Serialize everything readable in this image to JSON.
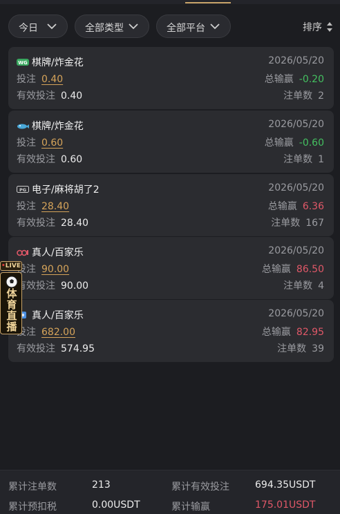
{
  "filters": {
    "date": "今日",
    "type": "全部类型",
    "platform": "全部平台",
    "sort": "排序"
  },
  "records": [
    {
      "title": "棋牌/炸金花",
      "date": "2026/05/20",
      "bet_label": "投注",
      "bet": "0.40",
      "win_label": "总输赢",
      "win": "-0.20",
      "win_sign": "neg",
      "valid_label": "有效投注",
      "valid": "0.40",
      "count_label": "注单数",
      "count": "2",
      "logo": "wg-logo"
    },
    {
      "title": "棋牌/炸金花",
      "date": "2026/05/20",
      "bet_label": "投注",
      "bet": "0.60",
      "win_label": "总输赢",
      "win": "-0.60",
      "win_sign": "neg",
      "valid_label": "有效投注",
      "valid": "0.60",
      "count_label": "注单数",
      "count": "1",
      "logo": "fish-logo"
    },
    {
      "title": "电子/麻将胡了2",
      "date": "2026/05/20",
      "bet_label": "投注",
      "bet": "28.40",
      "win_label": "总输赢",
      "win": "6.36",
      "win_sign": "pos",
      "valid_label": "有效投注",
      "valid": "28.40",
      "count_label": "注单数",
      "count": "167",
      "logo": "pg-logo"
    },
    {
      "title": "真人/百家乐",
      "date": "2026/05/20",
      "bet_label": "投注",
      "bet": "90.00",
      "win_label": "总输赢",
      "win": "86.50",
      "win_sign": "pos",
      "valid_label": "有效投注",
      "valid": "90.00",
      "count_label": "注单数",
      "count": "4",
      "logo": "ob-logo"
    },
    {
      "title": "真人/百家乐",
      "date": "2026/05/20",
      "bet_label": "投注",
      "bet": "682.00",
      "win_label": "总输赢",
      "win": "82.95",
      "win_sign": "pos",
      "valid_label": "有效投注",
      "valid": "574.95",
      "count_label": "注单数",
      "count": "39",
      "logo": "blue-logo"
    }
  ],
  "live_badge": {
    "tag": "LIVE",
    "text": "体育直播"
  },
  "summary": {
    "total_bets_label": "累计注单数",
    "total_bets": "213",
    "total_valid_label": "累计有效投注",
    "total_valid": "694.35USDT",
    "tax_label": "累计预扣税",
    "tax": "0.00USDT",
    "total_win_label": "累计输赢",
    "total_win": "175.01USDT"
  },
  "colors": {
    "background": "#1c1d21",
    "card": "#2b2c30",
    "gold": "#d6a45a",
    "positive": "#e05868",
    "negative": "#44c060"
  }
}
